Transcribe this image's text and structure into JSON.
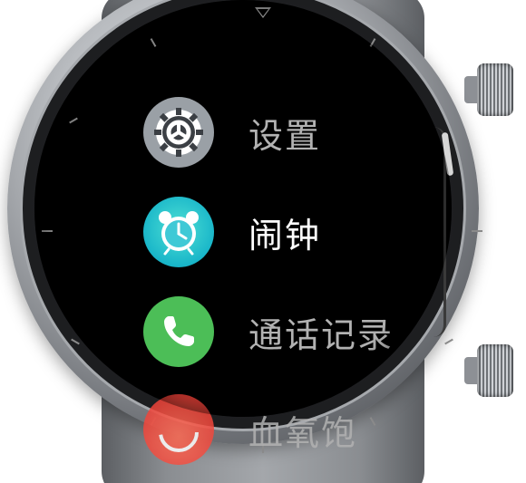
{
  "screen": {
    "menu_items": [
      {
        "label": "设置",
        "icon": "settings-gear-icon",
        "active": false
      },
      {
        "label": "闹钟",
        "icon": "alarm-clock-icon",
        "active": true
      },
      {
        "label": "通话记录",
        "icon": "phone-icon",
        "active": false
      },
      {
        "label": "血氧饱",
        "icon": "blood-oxygen-icon",
        "active": false
      }
    ],
    "colors": {
      "settings": "#9aa0a6",
      "alarm": "#19b6c9",
      "phone": "#4cbe57",
      "spo2": "#f0443a"
    }
  }
}
